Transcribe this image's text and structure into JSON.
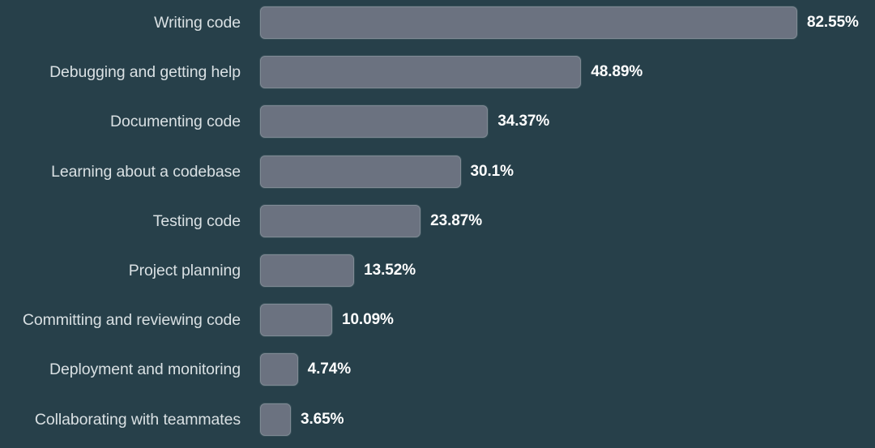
{
  "theme": {
    "background_color": "#27404a",
    "bar_fill_color": "#6b7280",
    "bar_border_color": "#7f8a94",
    "category_label_color": "#d9e0e3",
    "value_label_color": "#ffffff"
  },
  "chart_data": {
    "type": "bar",
    "orientation": "horizontal",
    "title": "",
    "subtitle": "",
    "xlabel": "",
    "ylabel": "",
    "grid": false,
    "legend": "none",
    "axis_visible": false,
    "value_suffix": "%",
    "xlim": [
      0,
      82.55
    ],
    "categories": [
      "Writing code",
      "Debugging and getting help",
      "Documenting code",
      "Learning about a codebase",
      "Testing code",
      "Project planning",
      "Committing and reviewing code",
      "Deployment and monitoring",
      "Collaborating with teammates"
    ],
    "values": [
      82.55,
      48.89,
      34.37,
      30.1,
      23.87,
      13.52,
      10.09,
      4.74,
      3.65
    ],
    "value_labels": [
      "82.55%",
      "48.89%",
      "34.37%",
      "30.1%",
      "23.87%",
      "13.52%",
      "10.09%",
      "4.74%",
      "3.65%"
    ]
  },
  "rows": [
    {
      "label": "Writing code",
      "value": 82.55,
      "value_label": "82.55%"
    },
    {
      "label": "Debugging and getting help",
      "value": 48.89,
      "value_label": "48.89%"
    },
    {
      "label": "Documenting code",
      "value": 34.37,
      "value_label": "34.37%"
    },
    {
      "label": "Learning about a codebase",
      "value": 30.1,
      "value_label": "30.1%"
    },
    {
      "label": "Testing code",
      "value": 23.87,
      "value_label": "23.87%"
    },
    {
      "label": "Project planning",
      "value": 13.52,
      "value_label": "13.52%"
    },
    {
      "label": "Committing and reviewing code",
      "value": 10.09,
      "value_label": "10.09%"
    },
    {
      "label": "Deployment and monitoring",
      "value": 4.74,
      "value_label": "4.74%"
    },
    {
      "label": "Collaborating with teammates",
      "value": 3.65,
      "value_label": "3.65%"
    }
  ]
}
